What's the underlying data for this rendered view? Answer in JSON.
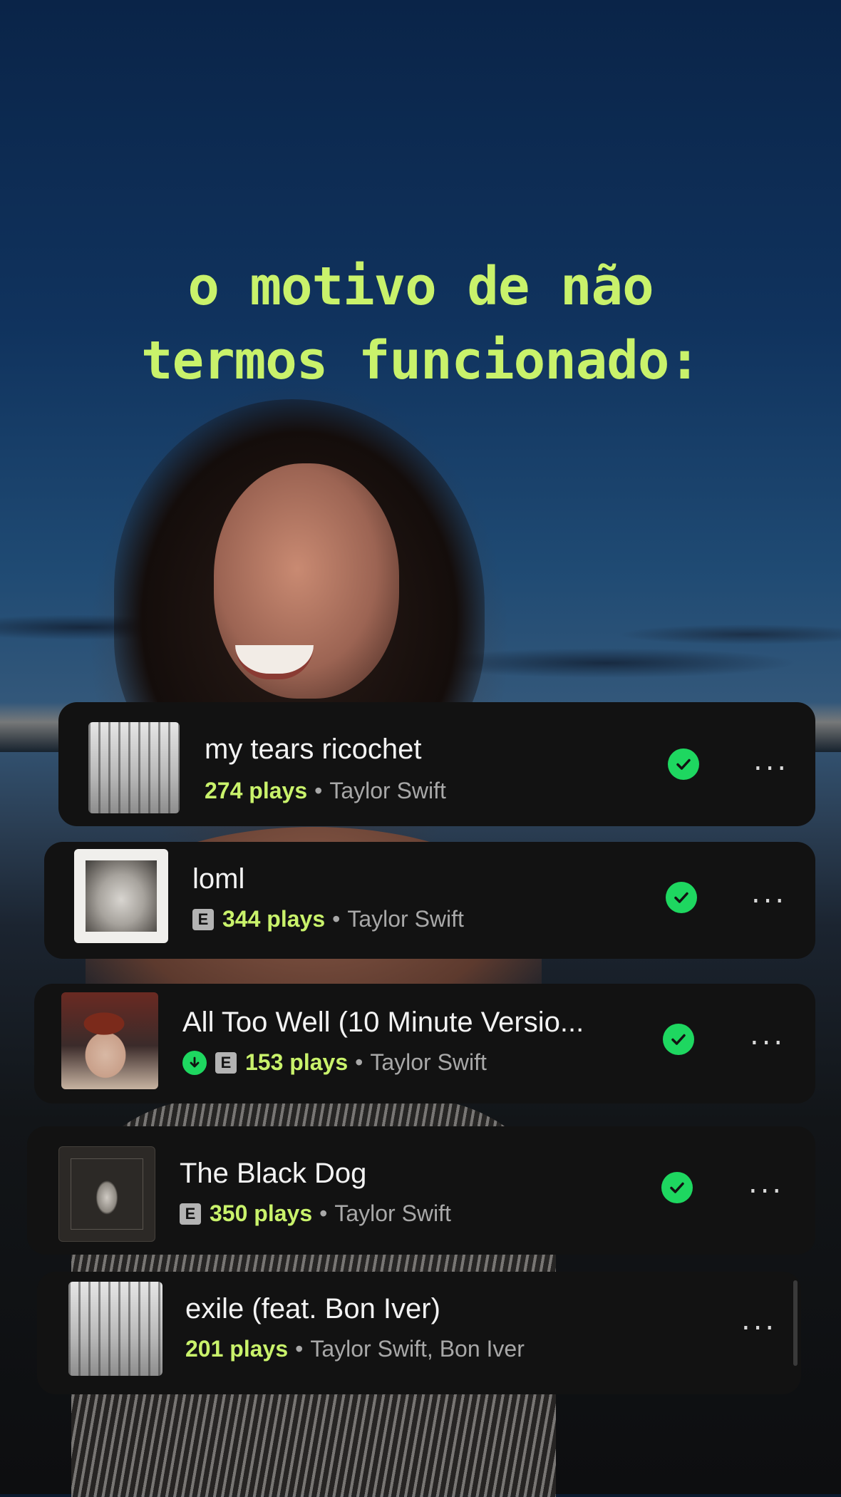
{
  "headline": {
    "line1": "o motivo de não",
    "line2": "termos funcionado:"
  },
  "tracks": [
    {
      "title": "my tears ricochet",
      "explicit": false,
      "downloaded": false,
      "plays": "274 plays",
      "artist": "Taylor Swift",
      "saved": true
    },
    {
      "title": "loml",
      "explicit": true,
      "downloaded": false,
      "plays": "344 plays",
      "artist": "Taylor Swift",
      "saved": true
    },
    {
      "title": "All Too Well (10 Minute Versio...",
      "explicit": true,
      "downloaded": true,
      "plays": "153 plays",
      "artist": "Taylor Swift",
      "saved": true
    },
    {
      "title": "The Black Dog",
      "explicit": true,
      "downloaded": false,
      "plays": "350 plays",
      "artist": "Taylor Swift",
      "saved": true
    },
    {
      "title": "exile (feat. Bon Iver)",
      "explicit": false,
      "downloaded": false,
      "plays": "201 plays",
      "artist": "Taylor Swift, Bon Iver",
      "saved": false
    }
  ],
  "labels": {
    "explicit": "E",
    "separator": "•",
    "more": "..."
  },
  "colors": {
    "accent_text": "#c9f26b",
    "saved_green": "#1ed760",
    "card_bg": "#121212"
  },
  "icons": {
    "saved": "check-circle-icon",
    "downloaded": "download-arrow-icon",
    "more": "ellipsis-icon"
  }
}
